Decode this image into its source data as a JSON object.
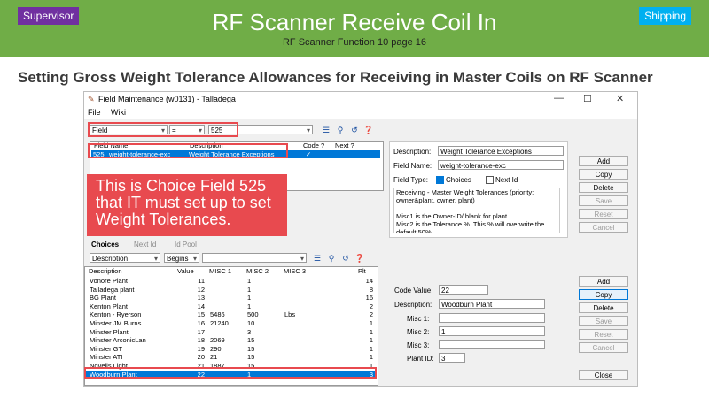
{
  "header": {
    "left_tag": "Supervisor",
    "right_tag": "Shipping",
    "title": "RF Scanner Receive Coil In",
    "subtitle": "RF Scanner Function 10",
    "page": "page 16"
  },
  "heading": "Setting Gross Weight Tolerance Allowances for Receiving in Master Coils on RF Scanner",
  "window": {
    "title": "Field Maintenance (w0131) - Talladega",
    "menu": [
      "File",
      "Wiki"
    ],
    "controls": {
      "minimize": "—",
      "maximize": "☐",
      "close": "✕"
    }
  },
  "top_search": {
    "field": "Field",
    "operator": "=",
    "value": "525"
  },
  "fields_grid": {
    "headers": [
      "Field Name",
      "Description",
      "Code ?",
      "Next ?"
    ],
    "row": {
      "number": "525",
      "name": "weight-tolerance-exc",
      "description": "Weight Tolerance Exceptions",
      "code": "✓"
    }
  },
  "callout": "This is Choice Field 525 that IT must set up to set Weight Tolerances.",
  "field_detail": {
    "description_label": "Description:",
    "description": "Weight Tolerance Exceptions",
    "field_name_label": "Field Name:",
    "field_name": "weight-tolerance-exc",
    "field_type_label": "Field Type:",
    "choices_label": "Choices",
    "next_id_label": "Next Id",
    "notes": "Receiving - Master Weight Tolerances (priority: owner&plant, owner, plant)\n\nMisc1 is the Owner-ID/ blank for plant\nMisc2 is the Tolerance %. This % will overwrite the default 50%.\nMisc3 is if \"Lbs\" is entered, then the value"
  },
  "top_buttons": [
    "Add",
    "Copy",
    "Delete",
    "Save",
    "Reset",
    "Cancel"
  ],
  "tabs": [
    "Choices",
    "Next Id",
    "Id Pool"
  ],
  "choice_search": {
    "field": "Description",
    "operator": "Begins",
    "value": ""
  },
  "choices_grid": {
    "headers": [
      "Description",
      "Value",
      "MISC 1",
      "MISC 2",
      "MISC 3",
      "Plt"
    ],
    "rows": [
      [
        "Vonore Plant",
        "11",
        "",
        "1",
        "",
        "14"
      ],
      [
        "Talladega plant",
        "12",
        "",
        "1",
        "",
        "8"
      ],
      [
        "BG Plant",
        "13",
        "",
        "1",
        "",
        "16"
      ],
      [
        "Kenton Plant",
        "14",
        "",
        "1",
        "",
        "2"
      ],
      [
        "Kenton - Ryerson",
        "15",
        "5486",
        "500",
        "Lbs",
        "2"
      ],
      [
        "Minster JM Burns",
        "16",
        "21240",
        "10",
        "",
        "1"
      ],
      [
        "Minster Plant",
        "17",
        "",
        "3",
        "",
        "1"
      ],
      [
        "Minster ArconicLan",
        "18",
        "2069",
        "15",
        "",
        "1"
      ],
      [
        "Minster GT",
        "19",
        "290",
        "15",
        "",
        "1"
      ],
      [
        "Minster ATI",
        "20",
        "21",
        "15",
        "",
        "1"
      ],
      [
        "Novelis Light",
        "21",
        "1887",
        "15",
        "",
        "1"
      ],
      [
        "Woodburn Plant",
        "22",
        "",
        "1",
        "",
        "3"
      ]
    ],
    "selected_index": 11
  },
  "choice_detail": {
    "code_value_label": "Code Value:",
    "code_value": "22",
    "description_label": "Description:",
    "description": "Woodburn Plant",
    "misc1_label": "Misc 1:",
    "misc1": "",
    "misc2_label": "Misc 2:",
    "misc2": "1",
    "misc3_label": "Misc 3:",
    "misc3": "",
    "plant_id_label": "Plant ID:",
    "plant_id": "3"
  },
  "bottom_buttons": [
    "Add",
    "Copy",
    "Delete",
    "Save",
    "Reset",
    "Cancel"
  ],
  "close_button": "Close"
}
